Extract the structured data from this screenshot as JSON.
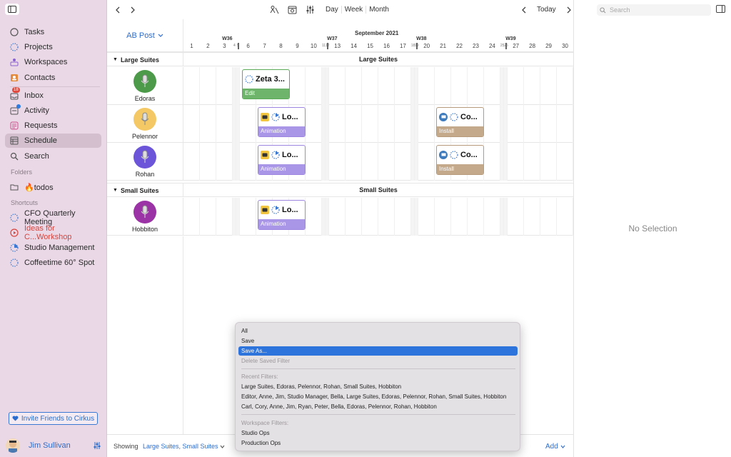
{
  "sidebar": {
    "nav": [
      {
        "label": "Tasks",
        "icon": "circle-outline-icon"
      },
      {
        "label": "Projects",
        "icon": "dotted-circle-icon"
      },
      {
        "label": "Workspaces",
        "icon": "workspaces-icon"
      },
      {
        "label": "Contacts",
        "icon": "contacts-icon"
      }
    ],
    "nav2": [
      {
        "label": "Inbox",
        "icon": "inbox-icon",
        "badge": "18"
      },
      {
        "label": "Activity",
        "icon": "activity-icon"
      },
      {
        "label": "Requests",
        "icon": "requests-icon"
      },
      {
        "label": "Schedule",
        "icon": "schedule-icon"
      },
      {
        "label": "Search",
        "icon": "search-icon"
      }
    ],
    "folders_heading": "Folders",
    "folder": {
      "label": "🔥todos"
    },
    "shortcuts_heading": "Shortcuts",
    "shortcuts": [
      {
        "label": "CFO Quarterly Meeting"
      },
      {
        "label": "Ideas for C...Workshop"
      },
      {
        "label": "Studio Management"
      },
      {
        "label": "Coffeetime 60° Spot"
      }
    ],
    "invite_label": "Invite Friends to Cirkus",
    "user_name": "Jim Sullivan"
  },
  "toolbar": {
    "view_day": "Day",
    "view_week": "Week",
    "view_month": "Month",
    "today": "Today"
  },
  "inspector": {
    "search_placeholder": "Search",
    "no_selection": "No Selection"
  },
  "schedule": {
    "resource_group": "AB Post",
    "month_label": "September 2021",
    "weeks": [
      "W36",
      "W37",
      "W38",
      "W39"
    ],
    "sections": [
      {
        "name": "Large Suites"
      },
      {
        "name": "Small Suites"
      }
    ],
    "resources": [
      {
        "name": "Edoras",
        "color": "#4c9a4a"
      },
      {
        "name": "Pelennor",
        "color": "#f3c865"
      },
      {
        "name": "Rohan",
        "color": "#6d55d9"
      },
      {
        "name": "Hobbiton",
        "color": "#9b33a6"
      }
    ],
    "events": [
      {
        "title": "Zeta 3...",
        "tag": "Edit"
      },
      {
        "title": "Lo...",
        "tag": "Animation"
      },
      {
        "title": "Co...",
        "tag": "Install"
      },
      {
        "title": "Lo...",
        "tag": "Animation"
      },
      {
        "title": "Co...",
        "tag": "Install"
      },
      {
        "title": "Lo...",
        "tag": "Animation"
      }
    ]
  },
  "bottombar": {
    "showing_label": "Showing",
    "showing_value": "Large Suites, Small Suites",
    "add_label": "Add"
  },
  "popup": {
    "all": "All",
    "save": "Save",
    "save_as": "Save As...",
    "delete": "Delete Saved Filter",
    "recent_heading": "Recent Filters:",
    "recent": [
      "Large Suites, Edoras, Pelennor, Rohan, Small Suites, Hobbiton",
      "Editor, Anne, Jim, Studio Manager, Bella, Large Suites, Edoras, Pelennor, Rohan, Small Suites, Hobbiton",
      "Carl, Cory, Anne, Jim, Ryan, Peter, Bella, Edoras, Pelennor, Rohan, Hobbiton"
    ],
    "workspace_heading": "Workspace Filters:",
    "workspace": [
      "Studio Ops",
      "Production Ops"
    ]
  }
}
